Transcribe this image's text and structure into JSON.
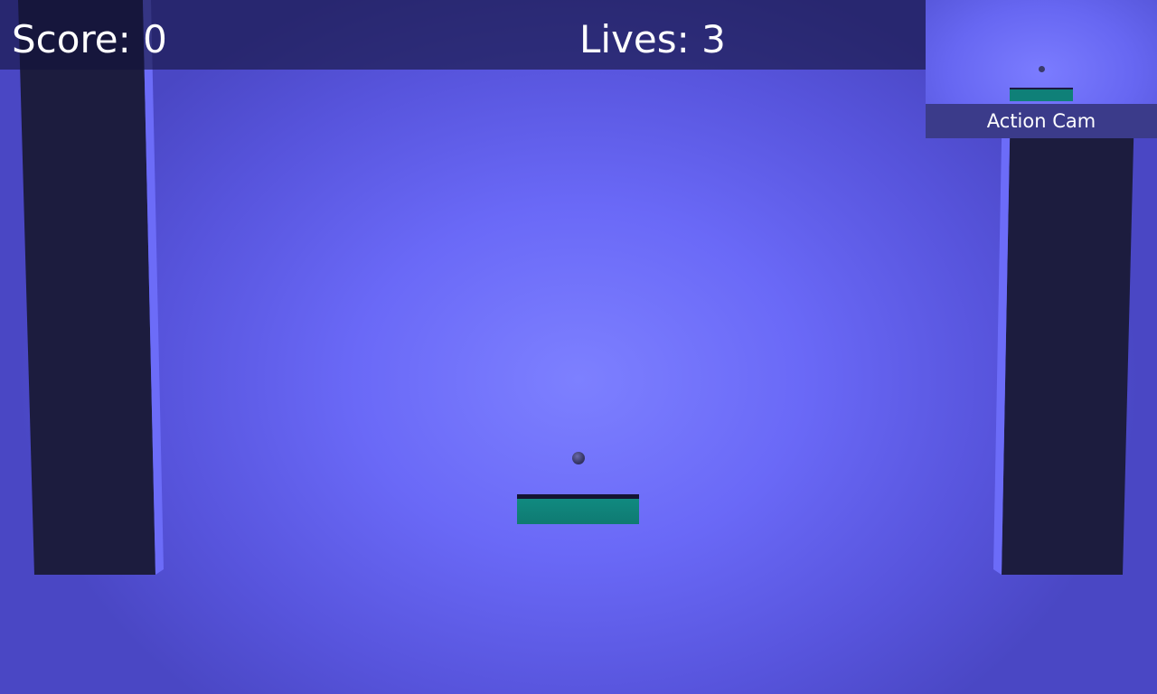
{
  "hud": {
    "score_text": "Score: 0",
    "lives_text": "Lives: 3"
  },
  "game": {
    "score": 0,
    "lives": 3
  },
  "action_cam": {
    "label": "Action Cam"
  },
  "colors": {
    "background": "#6a69f7",
    "pillar": "#1c1c3e",
    "pillar_edge": "#6c6cf8",
    "paddle": "#108a80",
    "paddle_top": "#141433",
    "ball": "#3a3a6a",
    "hud_text": "#ffffff"
  }
}
